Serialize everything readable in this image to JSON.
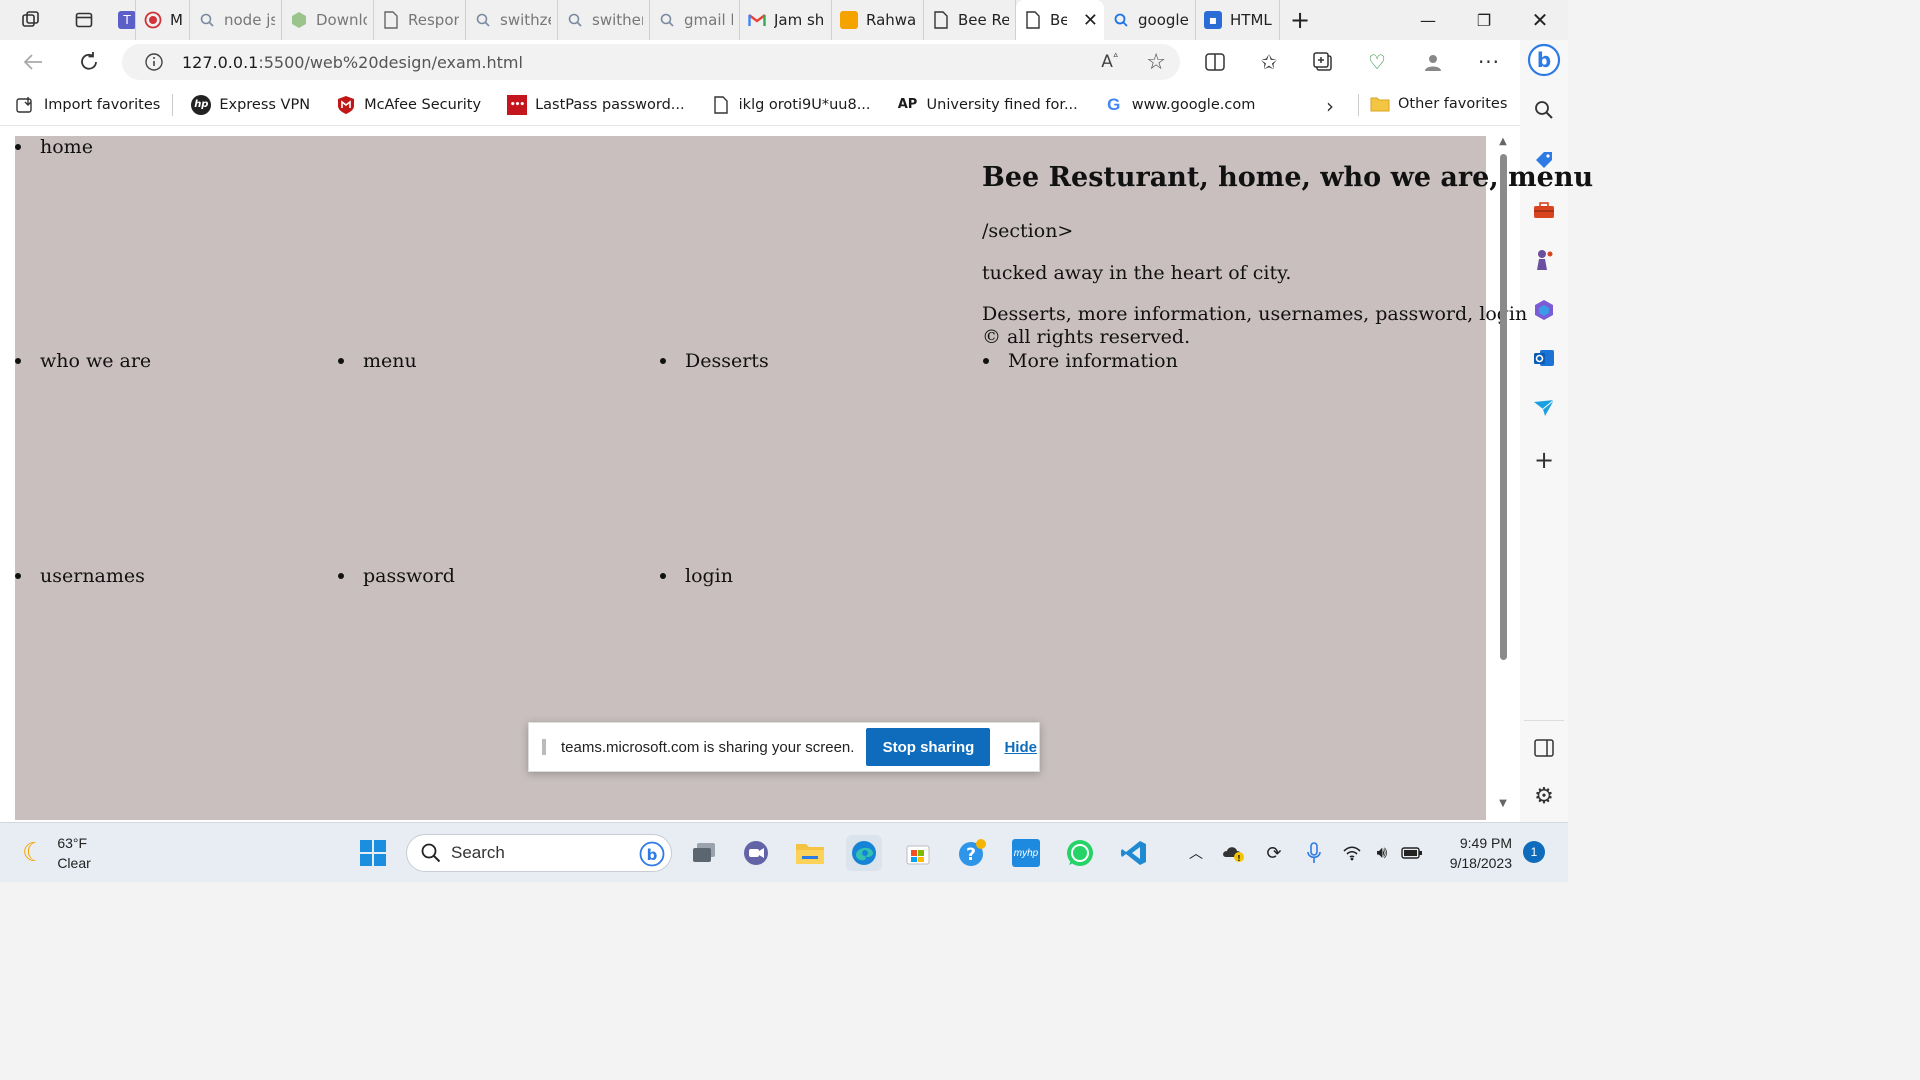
{
  "browser": {
    "tabs": [
      {
        "title": "",
        "icon": "teams-icon",
        "color": "#5b5fc7"
      },
      {
        "title": "Mi",
        "icon": "record-icon",
        "color": "#d13438"
      },
      {
        "title": "node js",
        "icon": "search-icon",
        "color": "#888888"
      },
      {
        "title": "Downlo",
        "icon": "hexagon-icon",
        "color": "#8fbf7f"
      },
      {
        "title": "Respon",
        "icon": "page-icon",
        "color": "#666666"
      },
      {
        "title": "swithze",
        "icon": "search-icon",
        "color": "#888888"
      },
      {
        "title": "swither",
        "icon": "search-icon",
        "color": "#888888"
      },
      {
        "title": "gmail lo",
        "icon": "search-icon",
        "color": "#888888"
      },
      {
        "title": "Jam sh",
        "icon": "gmail-icon",
        "color": "#ea4335"
      },
      {
        "title": "Rahwa",
        "icon": "hand-icon",
        "color": "#f4a300"
      },
      {
        "title": "Bee Re",
        "icon": "page-icon",
        "color": "#666666"
      },
      {
        "title": "Be",
        "icon": "page-icon",
        "color": "#666666",
        "active": true
      },
      {
        "title": "google",
        "icon": "search-icon",
        "color": "#1a73e8"
      },
      {
        "title": "HTML",
        "icon": "profile-icon",
        "color": "#2b6cd6"
      }
    ],
    "address": {
      "host": "127.0.0.1",
      "path": ":5500/web%20design/exam.html"
    },
    "favorites": [
      {
        "label": "Import favorites",
        "icon": "import-icon"
      },
      {
        "label": "Express VPN",
        "icon": "hp-icon"
      },
      {
        "label": "McAfee Security",
        "icon": "mcafee-icon"
      },
      {
        "label": "LastPass password...",
        "icon": "lastpass-icon"
      },
      {
        "label": "iklg oroti9U*uu8...",
        "icon": "page-icon"
      },
      {
        "label": "University fined for...",
        "icon": "ap-icon"
      },
      {
        "label": "www.google.com",
        "icon": "google-icon"
      }
    ],
    "other_favorites": "Other favorites",
    "ap_text": "AP",
    "g_text": "G",
    "hp_text": "hp"
  },
  "page": {
    "nav_row1": [
      "home"
    ],
    "nav_row2": [
      "who we are",
      "menu",
      "Desserts",
      "More information"
    ],
    "nav_row3": [
      "usernames",
      "password",
      "login"
    ],
    "heading": "Bee Resturant, home, who we are, menu",
    "p1": "/section>",
    "p2": "tucked away in the heart of city.",
    "p3": "Desserts, more information, usernames, password, login",
    "p4": "© all rights reserved."
  },
  "share_banner": {
    "message": "teams.microsoft.com is sharing your screen.",
    "stop_label": "Stop sharing",
    "hide_label": "Hide"
  },
  "taskbar": {
    "temperature": "63°F",
    "condition": "Clear",
    "search_label": "Search",
    "time": "9:49 PM",
    "date": "9/18/2023",
    "notifications": "1",
    "myhp_text": "myhp"
  }
}
